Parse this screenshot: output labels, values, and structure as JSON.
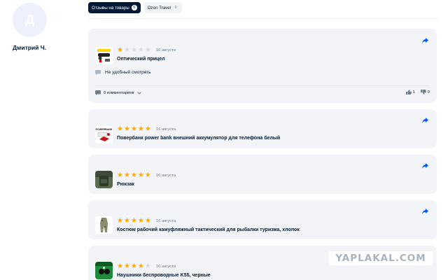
{
  "profile": {
    "avatar_letter": "Д",
    "name": "Дмитрий Ч."
  },
  "tabs": [
    {
      "label": "Отзывы на товары",
      "count": "6",
      "active": true
    },
    {
      "label": "Ozon Travel",
      "count": "0",
      "active": false
    }
  ],
  "reviews": [
    {
      "rating": 1,
      "date": "16 августа",
      "title": "Оптический прицел",
      "comment": "Не удобный смотреть",
      "comments_label": "0 комментариев",
      "likes": "1",
      "dislikes": "0"
    },
    {
      "rating": 5,
      "date": "16 августа",
      "title": "Повербанк power bank внешний аккумулятор для телефона белый"
    },
    {
      "rating": 5,
      "date": "16 августа",
      "title": "Рюкзак"
    },
    {
      "rating": 5,
      "date": "16 августа",
      "title": "Костюм рабочий камуфляжный тактический для рыбалки туризма, хлопок"
    },
    {
      "rating": 4,
      "date": "16 августа",
      "title": "Наушники беспроводные K55, черные"
    }
  ],
  "thumb_labels": {
    "powerbank": "POWERBANK"
  },
  "watermark": "YAPLAKAL.COM",
  "colors": {
    "star": "#ffa800",
    "share": "#005bff",
    "card_bg": "#f3f4f7"
  }
}
